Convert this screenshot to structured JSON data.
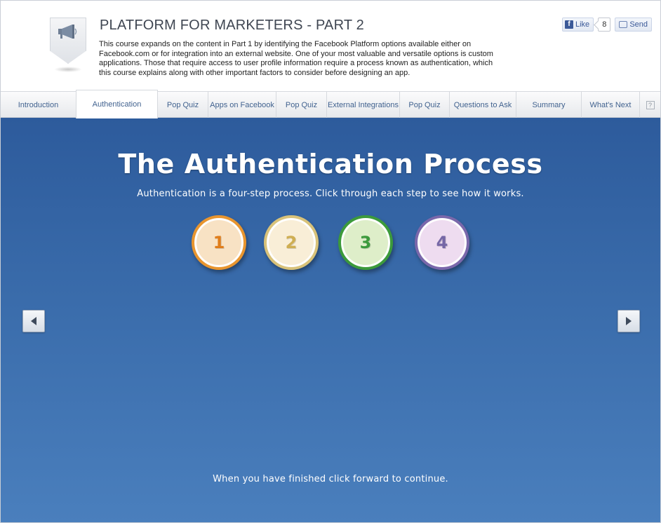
{
  "header": {
    "title": "PLATFORM FOR MARKETERS - PART 2",
    "description": "This course expands on the content in Part 1 by identifying the Facebook Platform options available either on Facebook.com or for integration into an external website. One of your most valuable and versatile options is custom applications. Those that require access to user profile information require a process known as authentication, which this course explains along with other important factors to consider before designing an app.",
    "icon": "megaphone-icon"
  },
  "social": {
    "like_label": "Like",
    "like_count": "8",
    "send_label": "Send",
    "brand_color": "#3b5998"
  },
  "tabs": [
    {
      "label": "Introduction",
      "active": false
    },
    {
      "label": "Authentication",
      "active": true
    },
    {
      "label": "Pop Quiz",
      "active": false
    },
    {
      "label": "Apps on Facebook",
      "active": false
    },
    {
      "label": "Pop Quiz",
      "active": false
    },
    {
      "label": "External Integrations",
      "active": false
    },
    {
      "label": "Pop Quiz",
      "active": false
    },
    {
      "label": "Questions to Ask",
      "active": false
    },
    {
      "label": "Summary",
      "active": false
    },
    {
      "label": "What's Next",
      "active": false
    },
    {
      "label": "?",
      "icon": "help-icon",
      "active": false
    }
  ],
  "stage": {
    "title": "The Authentication Process",
    "subtitle": "Authentication is a four-step process. Click through each step to see how it works.",
    "footer": "When you have finished click forward to continue.",
    "background_color": "#3a6cab",
    "steps": [
      {
        "label": "1",
        "ring_color": "#e8952f",
        "fill_color": "#f8e2c4",
        "text_color": "#e07d1a"
      },
      {
        "label": "2",
        "ring_color": "#d8c27a",
        "fill_color": "#f9eed7",
        "text_color": "#cfae52"
      },
      {
        "label": "3",
        "ring_color": "#3c9a3c",
        "fill_color": "#deeec9",
        "text_color": "#3c9a3c"
      },
      {
        "label": "4",
        "ring_color": "#7a68ab",
        "fill_color": "#eedcf0",
        "text_color": "#7567a6"
      }
    ],
    "prev_icon": "arrow-left-icon",
    "next_icon": "arrow-right-icon"
  }
}
